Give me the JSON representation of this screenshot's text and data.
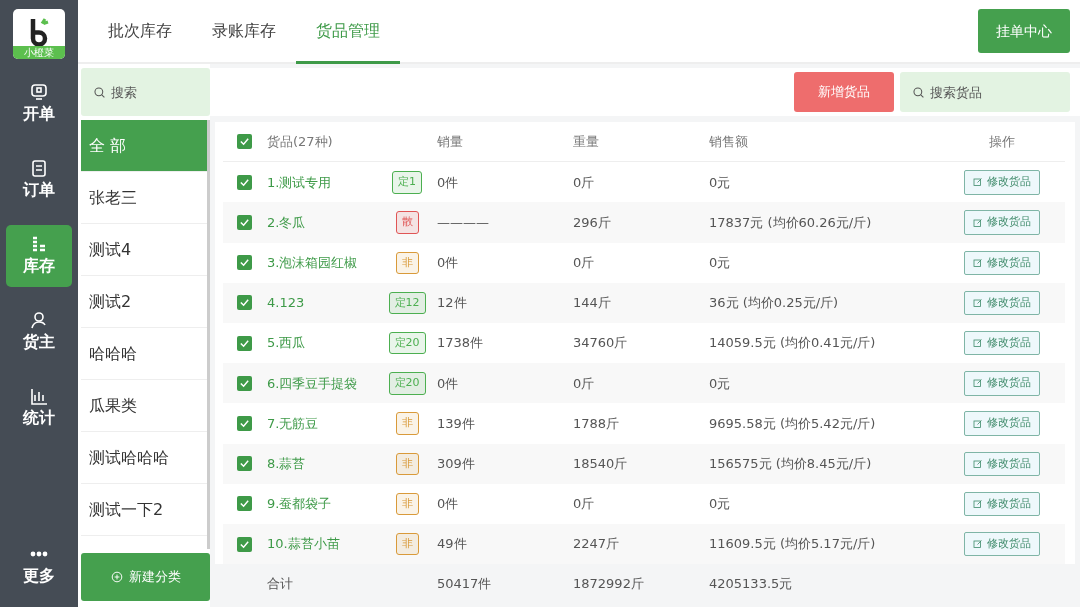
{
  "app": {
    "logo_text": "小橙菜"
  },
  "nav": [
    {
      "label": "开单",
      "selected": false
    },
    {
      "label": "订单",
      "selected": false
    },
    {
      "label": "库存",
      "selected": true
    },
    {
      "label": "货主",
      "selected": false
    },
    {
      "label": "统计",
      "selected": false
    }
  ],
  "nav_more": {
    "label": "更多"
  },
  "tabs": [
    {
      "label": "批次库存",
      "selected": false
    },
    {
      "label": "录账库存",
      "selected": false
    },
    {
      "label": "货品管理",
      "selected": true
    }
  ],
  "top_button": "挂单中心",
  "category_search": {
    "placeholder": "搜索"
  },
  "categories": [
    {
      "label": "全 部",
      "selected": true
    },
    {
      "label": "张老三",
      "selected": false
    },
    {
      "label": "测试4",
      "selected": false
    },
    {
      "label": "测试2",
      "selected": false
    },
    {
      "label": "哈哈哈",
      "selected": false
    },
    {
      "label": "瓜果类",
      "selected": false
    },
    {
      "label": "测试哈哈哈",
      "selected": false
    },
    {
      "label": "测试一下2",
      "selected": false
    }
  ],
  "new_category_button": "新建分类",
  "add_goods_button": "新增货品",
  "goods_search": {
    "placeholder": "搜索货品"
  },
  "table": {
    "all_checked": true,
    "columns": [
      "货品(27种)",
      "销量",
      "重量",
      "销售额",
      "操作"
    ],
    "rows": [
      {
        "checked": true,
        "name": "1.测试专用",
        "tag": {
          "label": "定1",
          "color": "#4caf50"
        },
        "sales": "0件",
        "weight": "0斤",
        "amount": "0元",
        "action": "修改货品"
      },
      {
        "checked": true,
        "name": "2.冬瓜",
        "tag": {
          "label": "散",
          "color": "#e05555"
        },
        "sales": "————",
        "weight": "296斤",
        "amount": "17837元 (均价60.26元/斤)",
        "action": "修改货品"
      },
      {
        "checked": true,
        "name": "3.泡沫箱园红椒",
        "tag": {
          "label": "非",
          "color": "#d99a3a"
        },
        "sales": "0件",
        "weight": "0斤",
        "amount": "0元",
        "action": "修改货品"
      },
      {
        "checked": true,
        "name": "4.123",
        "tag": {
          "label": "定12",
          "color": "#4caf50"
        },
        "sales": "12件",
        "weight": "144斤",
        "amount": "36元 (均价0.25元/斤)",
        "action": "修改货品"
      },
      {
        "checked": true,
        "name": "5.西瓜",
        "tag": {
          "label": "定20",
          "color": "#4caf50"
        },
        "sales": "1738件",
        "weight": "34760斤",
        "amount": "14059.5元 (均价0.41元/斤)",
        "action": "修改货品"
      },
      {
        "checked": true,
        "name": "6.四季豆手提袋",
        "tag": {
          "label": "定20",
          "color": "#4caf50"
        },
        "sales": "0件",
        "weight": "0斤",
        "amount": "0元",
        "action": "修改货品"
      },
      {
        "checked": true,
        "name": "7.无筋豆",
        "tag": {
          "label": "非",
          "color": "#d99a3a"
        },
        "sales": "139件",
        "weight": "1788斤",
        "amount": "9695.58元 (均价5.42元/斤)",
        "action": "修改货品"
      },
      {
        "checked": true,
        "name": "8.蒜苔",
        "tag": {
          "label": "非",
          "color": "#d99a3a"
        },
        "sales": "309件",
        "weight": "18540斤",
        "amount": "156575元 (均价8.45元/斤)",
        "action": "修改货品"
      },
      {
        "checked": true,
        "name": "9.蚕都袋子",
        "tag": {
          "label": "非",
          "color": "#d99a3a"
        },
        "sales": "0件",
        "weight": "0斤",
        "amount": "0元",
        "action": "修改货品"
      },
      {
        "checked": true,
        "name": "10.蒜苔小苗",
        "tag": {
          "label": "非",
          "color": "#d99a3a"
        },
        "sales": "49件",
        "weight": "2247斤",
        "amount": "11609.5元 (均价5.17元/斤)",
        "action": "修改货品"
      }
    ],
    "footer": {
      "label": "合计",
      "sales": "50417件",
      "weight": "1872992斤",
      "amount": "4205133.5元"
    }
  }
}
